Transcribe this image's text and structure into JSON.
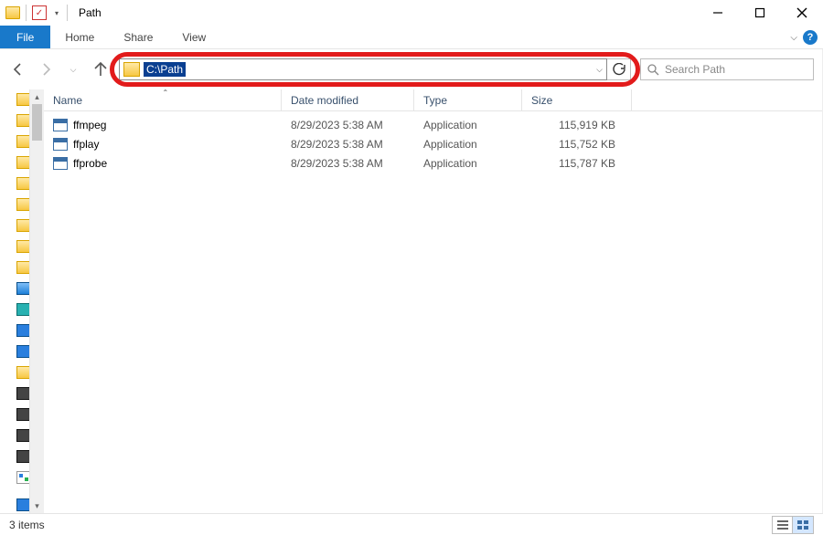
{
  "title": "Path",
  "menu": {
    "file": "File",
    "home": "Home",
    "share": "Share",
    "view": "View"
  },
  "address": {
    "path": "C:\\Path"
  },
  "search": {
    "placeholder": "Search Path"
  },
  "columns": {
    "name": "Name",
    "date": "Date modified",
    "type": "Type",
    "size": "Size"
  },
  "files": [
    {
      "name": "ffmpeg",
      "date": "8/29/2023 5:38 AM",
      "type": "Application",
      "size": "115,919 KB"
    },
    {
      "name": "ffplay",
      "date": "8/29/2023 5:38 AM",
      "type": "Application",
      "size": "115,752 KB"
    },
    {
      "name": "ffprobe",
      "date": "8/29/2023 5:38 AM",
      "type": "Application",
      "size": "115,787 KB"
    }
  ],
  "status": {
    "count": "3 items"
  }
}
